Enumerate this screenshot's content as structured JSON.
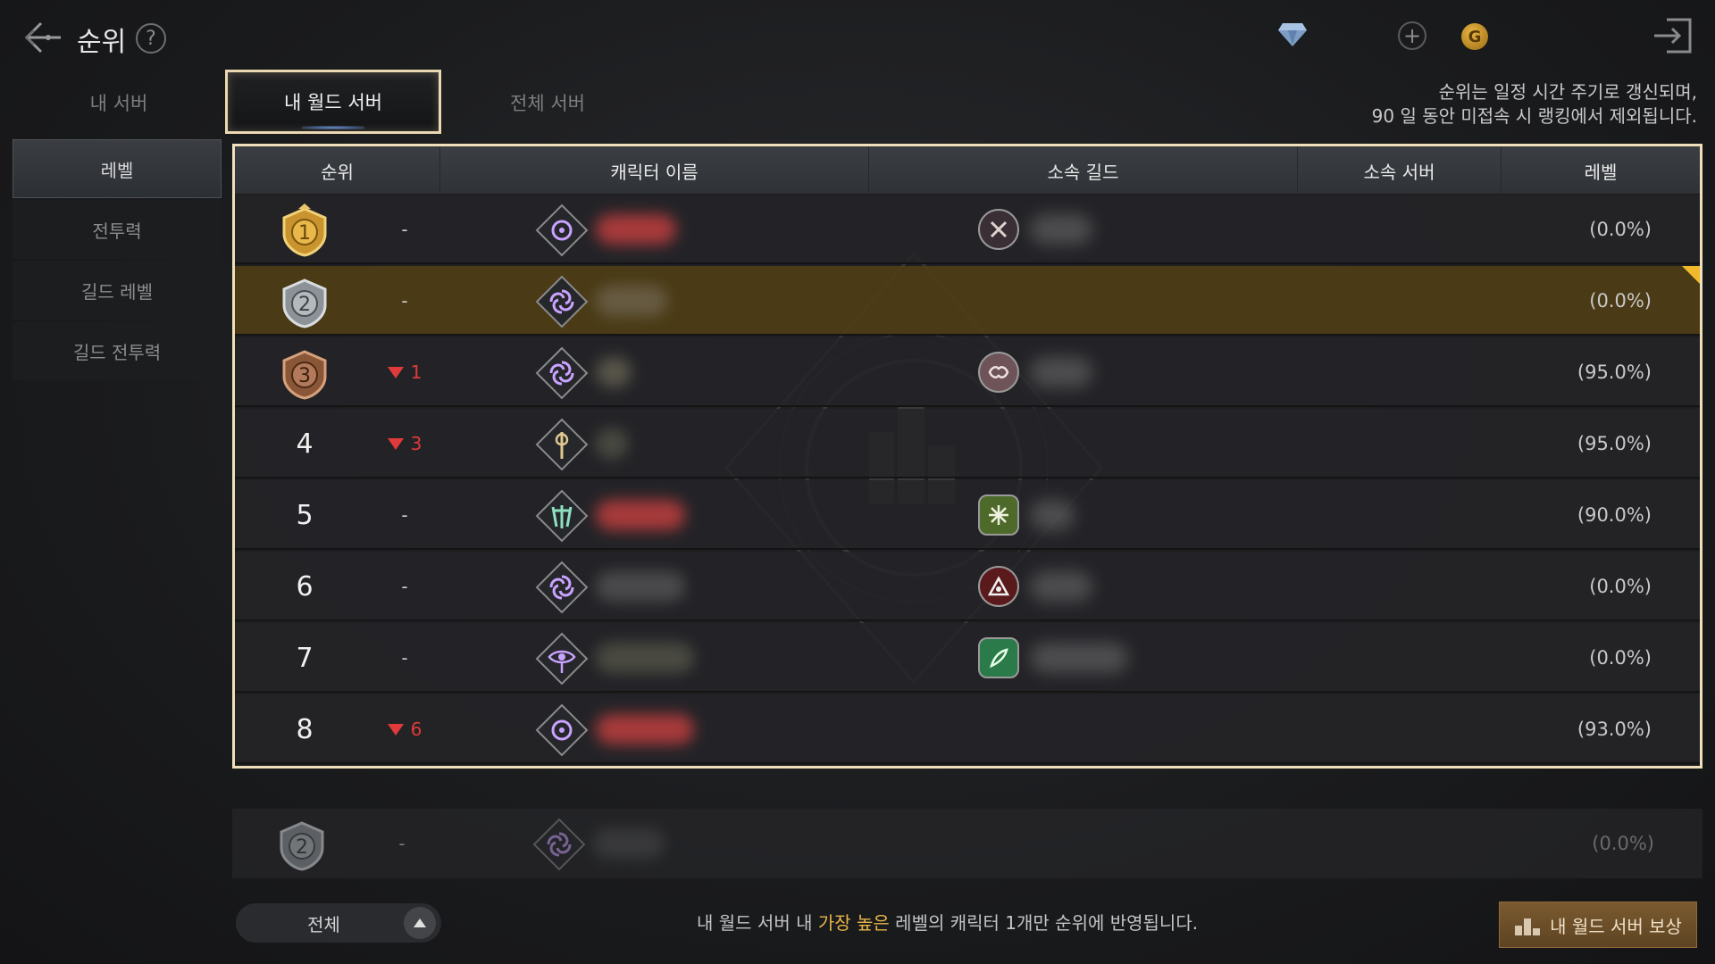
{
  "header": {
    "title": "순위",
    "help": "?",
    "plus": "+",
    "gold_symbol": "G"
  },
  "server_tabs": [
    {
      "label": "내 서버",
      "active": false
    },
    {
      "label": "내 월드 서버",
      "active": true
    },
    {
      "label": "전체 서버",
      "active": false
    }
  ],
  "notice": {
    "line1": "순위는 일정 시간 주기로 갱신되며,",
    "line2": "90 일 동안 미접속 시 랭킹에서 제외됩니다."
  },
  "categories": [
    {
      "label": "레벨",
      "active": true
    },
    {
      "label": "전투력",
      "active": false
    },
    {
      "label": "길드 레벨",
      "active": false
    },
    {
      "label": "길드 전투력",
      "active": false
    }
  ],
  "table": {
    "columns": [
      "순위",
      "캐릭터 이름",
      "소속 길드",
      "소속 서버",
      "레벨"
    ],
    "rows": [
      {
        "rank": "1",
        "badge": "gold",
        "change": "-",
        "change_dir": "none",
        "class_icon": "sorcerer-icon",
        "guild_icon": "guild-crest-icon",
        "level": "(0.0%)",
        "highlight": false
      },
      {
        "rank": "2",
        "badge": "silver",
        "change": "-",
        "change_dir": "none",
        "class_icon": "spiral-class-icon",
        "guild_icon": "",
        "level": "(0.0%)",
        "highlight": true
      },
      {
        "rank": "3",
        "badge": "bronze",
        "change": "1",
        "change_dir": "down",
        "class_icon": "spiral-class-icon",
        "guild_icon": "handshake-guild-icon",
        "level": "(95.0%)",
        "highlight": false
      },
      {
        "rank": "4",
        "badge": "",
        "change": "3",
        "change_dir": "down",
        "class_icon": "axe-class-icon",
        "guild_icon": "",
        "level": "(95.0%)",
        "highlight": false
      },
      {
        "rank": "5",
        "badge": "",
        "change": "-",
        "change_dir": "none",
        "class_icon": "claw-class-icon",
        "guild_icon": "green-star-guild-icon",
        "level": "(90.0%)",
        "highlight": false
      },
      {
        "rank": "6",
        "badge": "",
        "change": "-",
        "change_dir": "none",
        "class_icon": "spiral-class-icon",
        "guild_icon": "tri-guild-icon",
        "level": "(0.0%)",
        "highlight": false
      },
      {
        "rank": "7",
        "badge": "",
        "change": "-",
        "change_dir": "none",
        "class_icon": "eye-class-icon",
        "guild_icon": "feather-guild-icon",
        "level": "(0.0%)",
        "highlight": false
      },
      {
        "rank": "8",
        "badge": "",
        "change": "6",
        "change_dir": "down",
        "class_icon": "sorcerer-icon",
        "guild_icon": "",
        "level": "(93.0%)",
        "highlight": false
      }
    ]
  },
  "my_rank": {
    "rank": "2",
    "change": "-",
    "level": "(0.0%)"
  },
  "footer": {
    "filter_label": "전체",
    "note_before": "내 월드 서버 내 ",
    "note_highlight": "가장 높은",
    "note_after": " 레벨의 캐릭터 1개만 순위에 반영됩니다.",
    "reward_label": "내 월드 서버 보상"
  },
  "colors": {
    "accent_border": "#efdfba",
    "highlight_row": "#4e3e16",
    "rank_down": "#e03a3a",
    "note_highlight": "#e8b54a"
  }
}
